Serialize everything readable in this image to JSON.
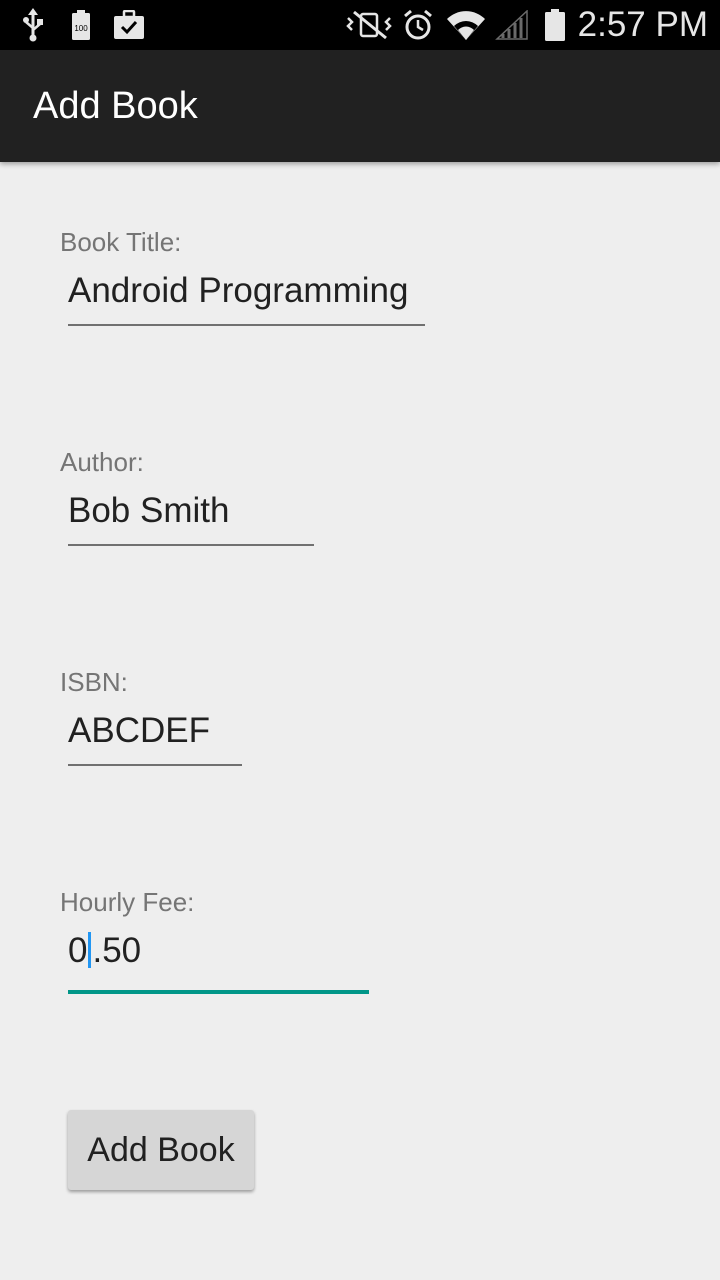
{
  "status_bar": {
    "time": "2:57 PM",
    "left_icons": [
      "usb-icon",
      "battery-100-icon",
      "briefcase-check-icon"
    ],
    "right_icons": [
      "vibrate-mute-icon",
      "alarm-icon",
      "wifi-icon",
      "signal-icon",
      "battery-icon"
    ],
    "battery_level_text": "100"
  },
  "action_bar": {
    "title": "Add Book"
  },
  "form": {
    "title_label": "Book Title:",
    "title_value": "Android Programming",
    "author_label": "Author:",
    "author_value": "Bob Smith",
    "isbn_label": "ISBN:",
    "isbn_value": "ABCDEF",
    "fee_label": "Hourly Fee:",
    "fee_value_before_cursor": "0",
    "fee_value_after_cursor": ".50",
    "submit_label": "Add Book"
  },
  "colors": {
    "accent": "#009688",
    "cursor": "#2196f3",
    "action_bar": "#212121",
    "background": "#eeeeee"
  }
}
